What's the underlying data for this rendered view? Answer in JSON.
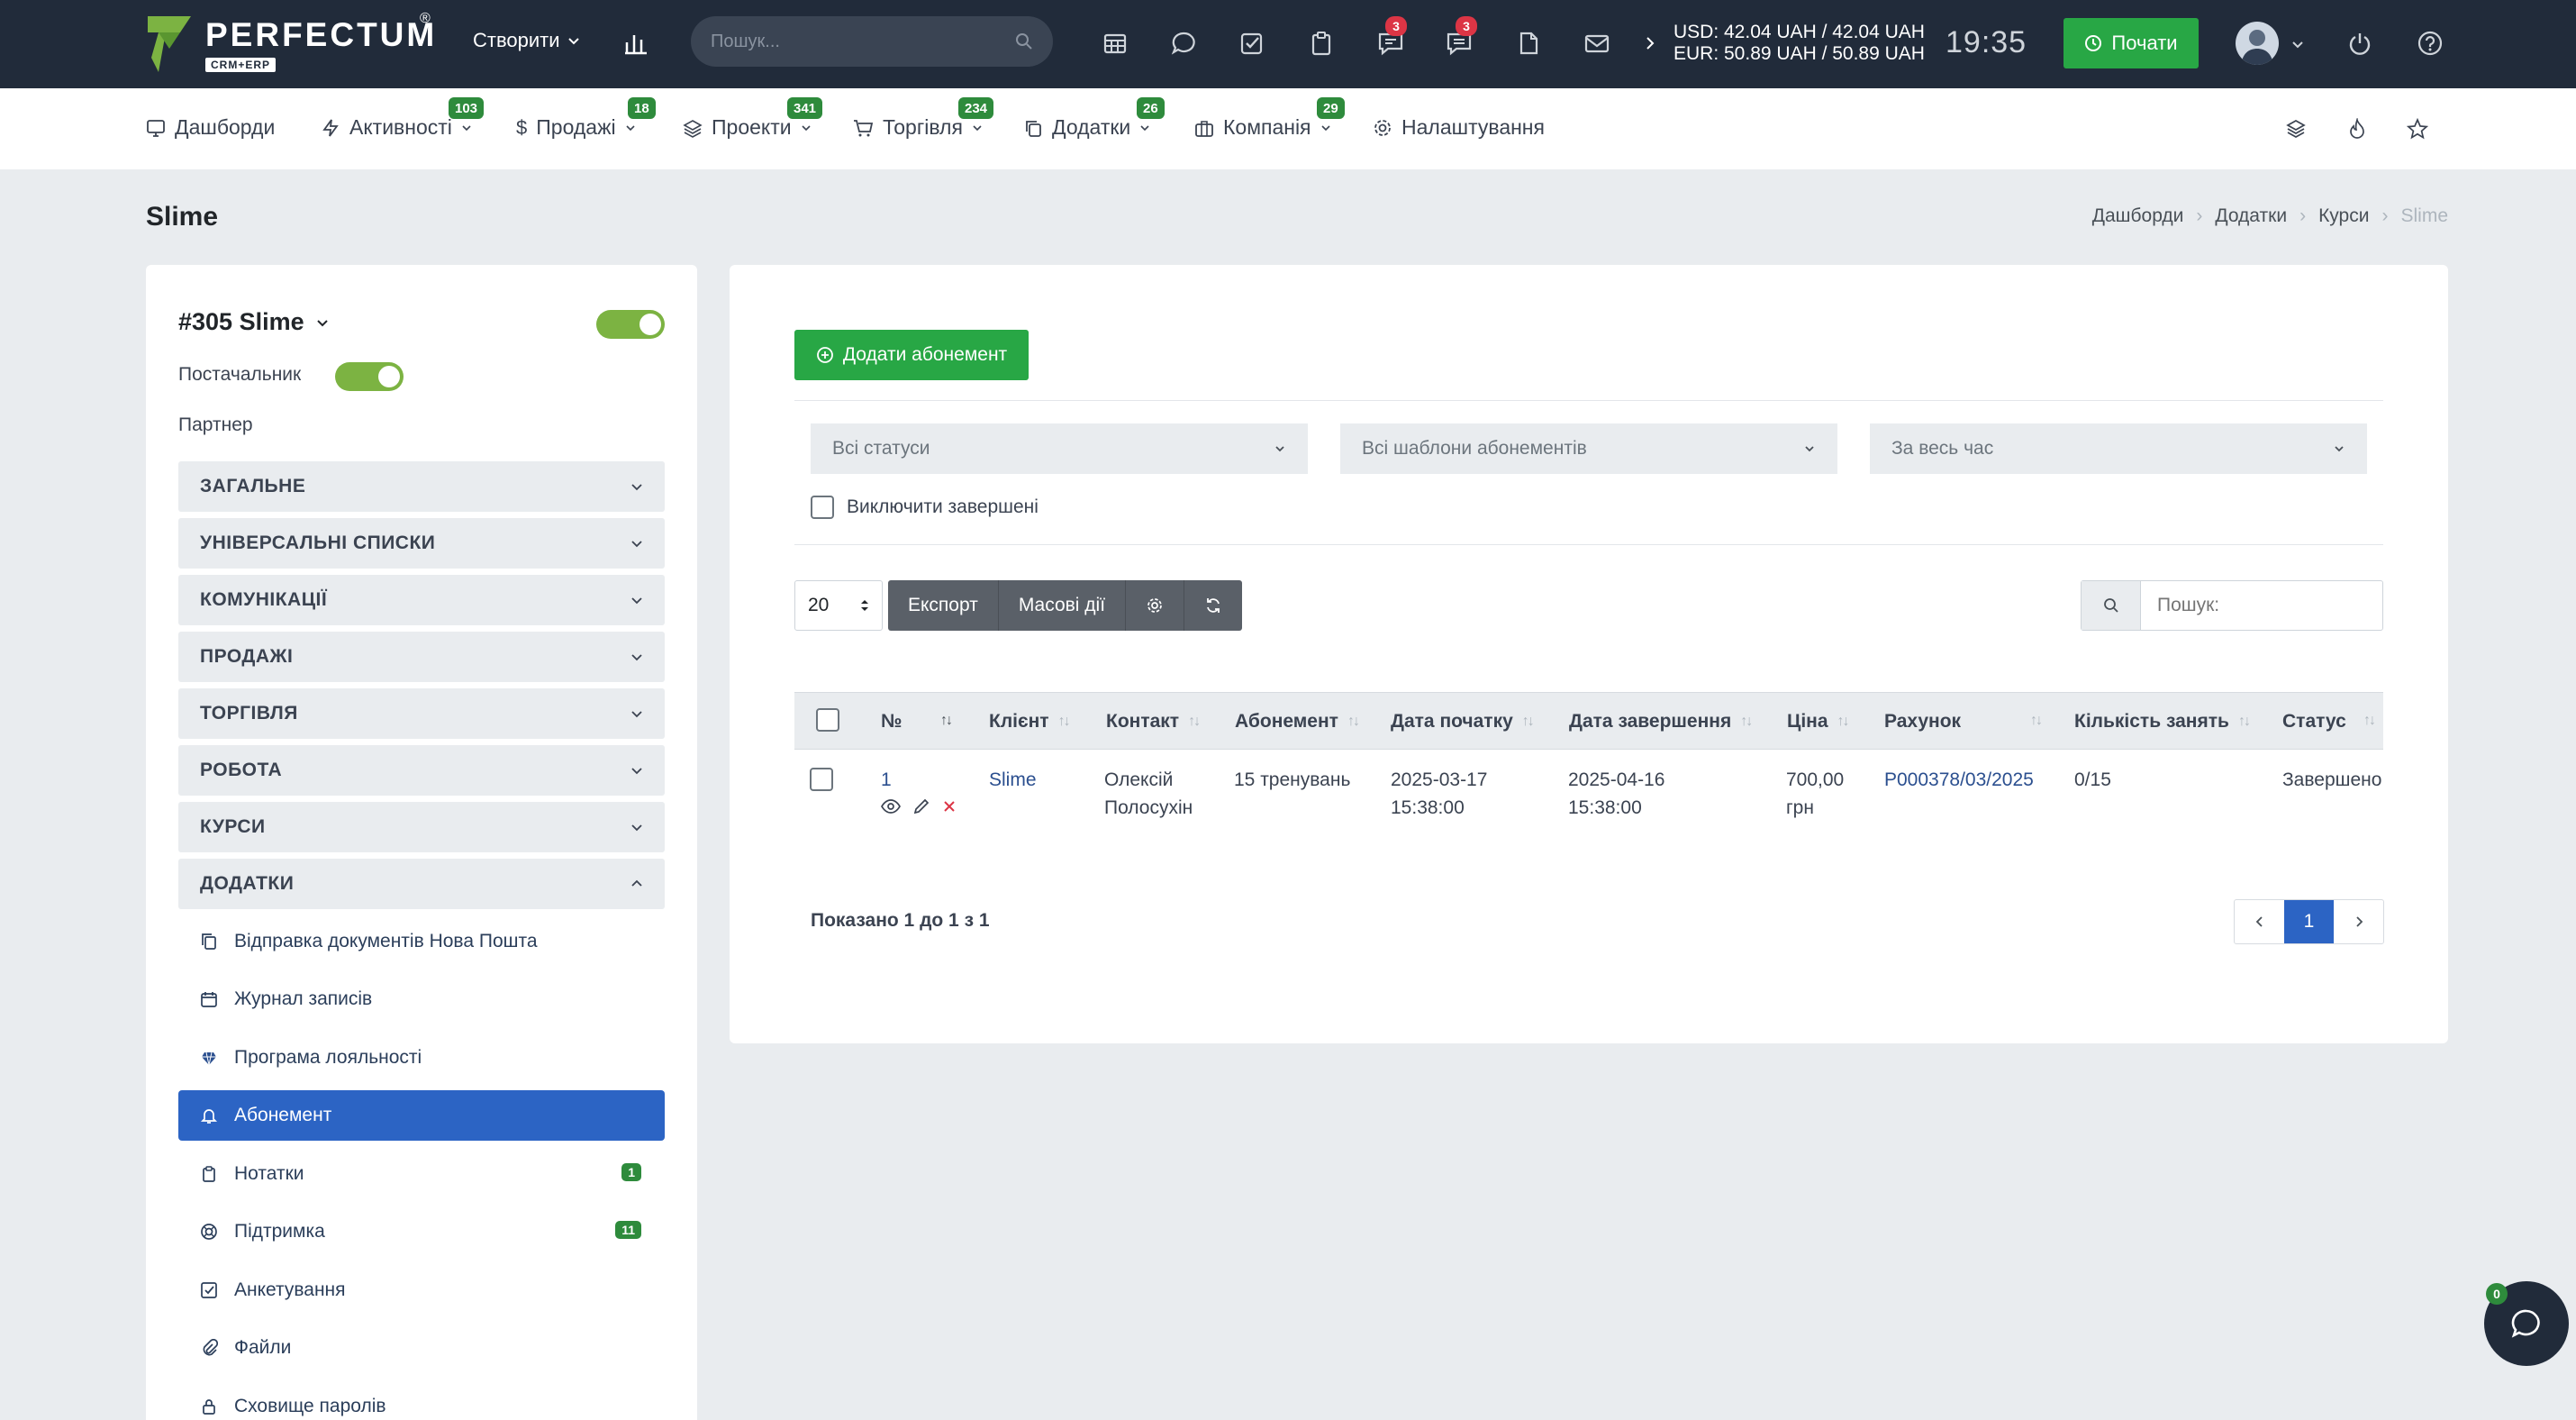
{
  "brand": {
    "name": "PERFECTUM",
    "sub": "CRM+ERP",
    "reg": "®"
  },
  "topbar": {
    "create_label": "Створити",
    "search_placeholder": "Пошук...",
    "badge_chat": "3",
    "badge_messages": "3",
    "currency_usd": "USD: 42.04 UAH / 42.04 UAH",
    "currency_eur": "EUR: 50.89 UAH / 50.89 UAH",
    "time": "19:35",
    "start_label": "Почати"
  },
  "nav": {
    "items": [
      {
        "label": "Дашборди",
        "badge": ""
      },
      {
        "label": "Активності",
        "badge": "103"
      },
      {
        "label": "Продажі",
        "badge": "18"
      },
      {
        "label": "Проекти",
        "badge": "341"
      },
      {
        "label": "Торгівля",
        "badge": "234"
      },
      {
        "label": "Додатки",
        "badge": "26"
      },
      {
        "label": "Компанія",
        "badge": "29"
      },
      {
        "label": "Налаштування",
        "badge": ""
      }
    ]
  },
  "page": {
    "title": "Slime",
    "breadcrumb": [
      "Дашборди",
      "Додатки",
      "Курси",
      "Slime"
    ]
  },
  "sidebar": {
    "entity_title": "#305 Slime",
    "supplier_label": "Постачальник",
    "partner_label": "Партнер",
    "sections": [
      "ЗАГАЛЬНЕ",
      "УНІВЕРСАЛЬНІ СПИСКИ",
      "КОМУНІКАЦІЇ",
      "ПРОДАЖІ",
      "ТОРГІВЛЯ",
      "РОБОТА",
      "КУРСИ",
      "ДОДАТКИ"
    ],
    "addons": [
      {
        "label": "Відправка документів Нова Пошта",
        "count": ""
      },
      {
        "label": "Журнал записів",
        "count": ""
      },
      {
        "label": "Програма лояльності",
        "count": ""
      },
      {
        "label": "Абонемент",
        "count": ""
      },
      {
        "label": "Нотатки",
        "count": "1"
      },
      {
        "label": "Підтримка",
        "count": "11"
      },
      {
        "label": "Анкетування",
        "count": ""
      },
      {
        "label": "Файли",
        "count": ""
      },
      {
        "label": "Сховище паролів",
        "count": ""
      }
    ]
  },
  "main": {
    "add_button": "Додати абонемент",
    "filters": {
      "status": "Всі статуси",
      "templates": "Всі шаблони абонементів",
      "period": "За весь час"
    },
    "exclude_completed": "Виключити завершені",
    "per_page": "20",
    "export": "Експорт",
    "mass_actions": "Масові дії",
    "search_placeholder": "Пошук:",
    "columns": [
      "№",
      "Клієнт",
      "Контакт",
      "Абонемент",
      "Дата початку",
      "Дата завершення",
      "Ціна",
      "Рахунок",
      "Кількість занять",
      "Статус"
    ],
    "rows": [
      {
        "num": "1",
        "client": "Slime",
        "contact_line1": "Олексій",
        "contact_line2": "Полосухін",
        "subscription": "15 тренувань",
        "start_date": "2025-03-17",
        "start_time": "15:38:00",
        "end_date": "2025-04-16",
        "end_time": "15:38:00",
        "price": "700,00",
        "currency": "грн",
        "invoice": "P000378/03/2025",
        "lessons": "0/15",
        "status": "Завершено"
      }
    ],
    "shown": "Показано 1 до 1 з 1",
    "page": "1"
  },
  "chat_badge": "0",
  "colors": {
    "topbar": "#212b3a",
    "accent_green": "#28a745",
    "active_blue": "#2c64c4"
  }
}
